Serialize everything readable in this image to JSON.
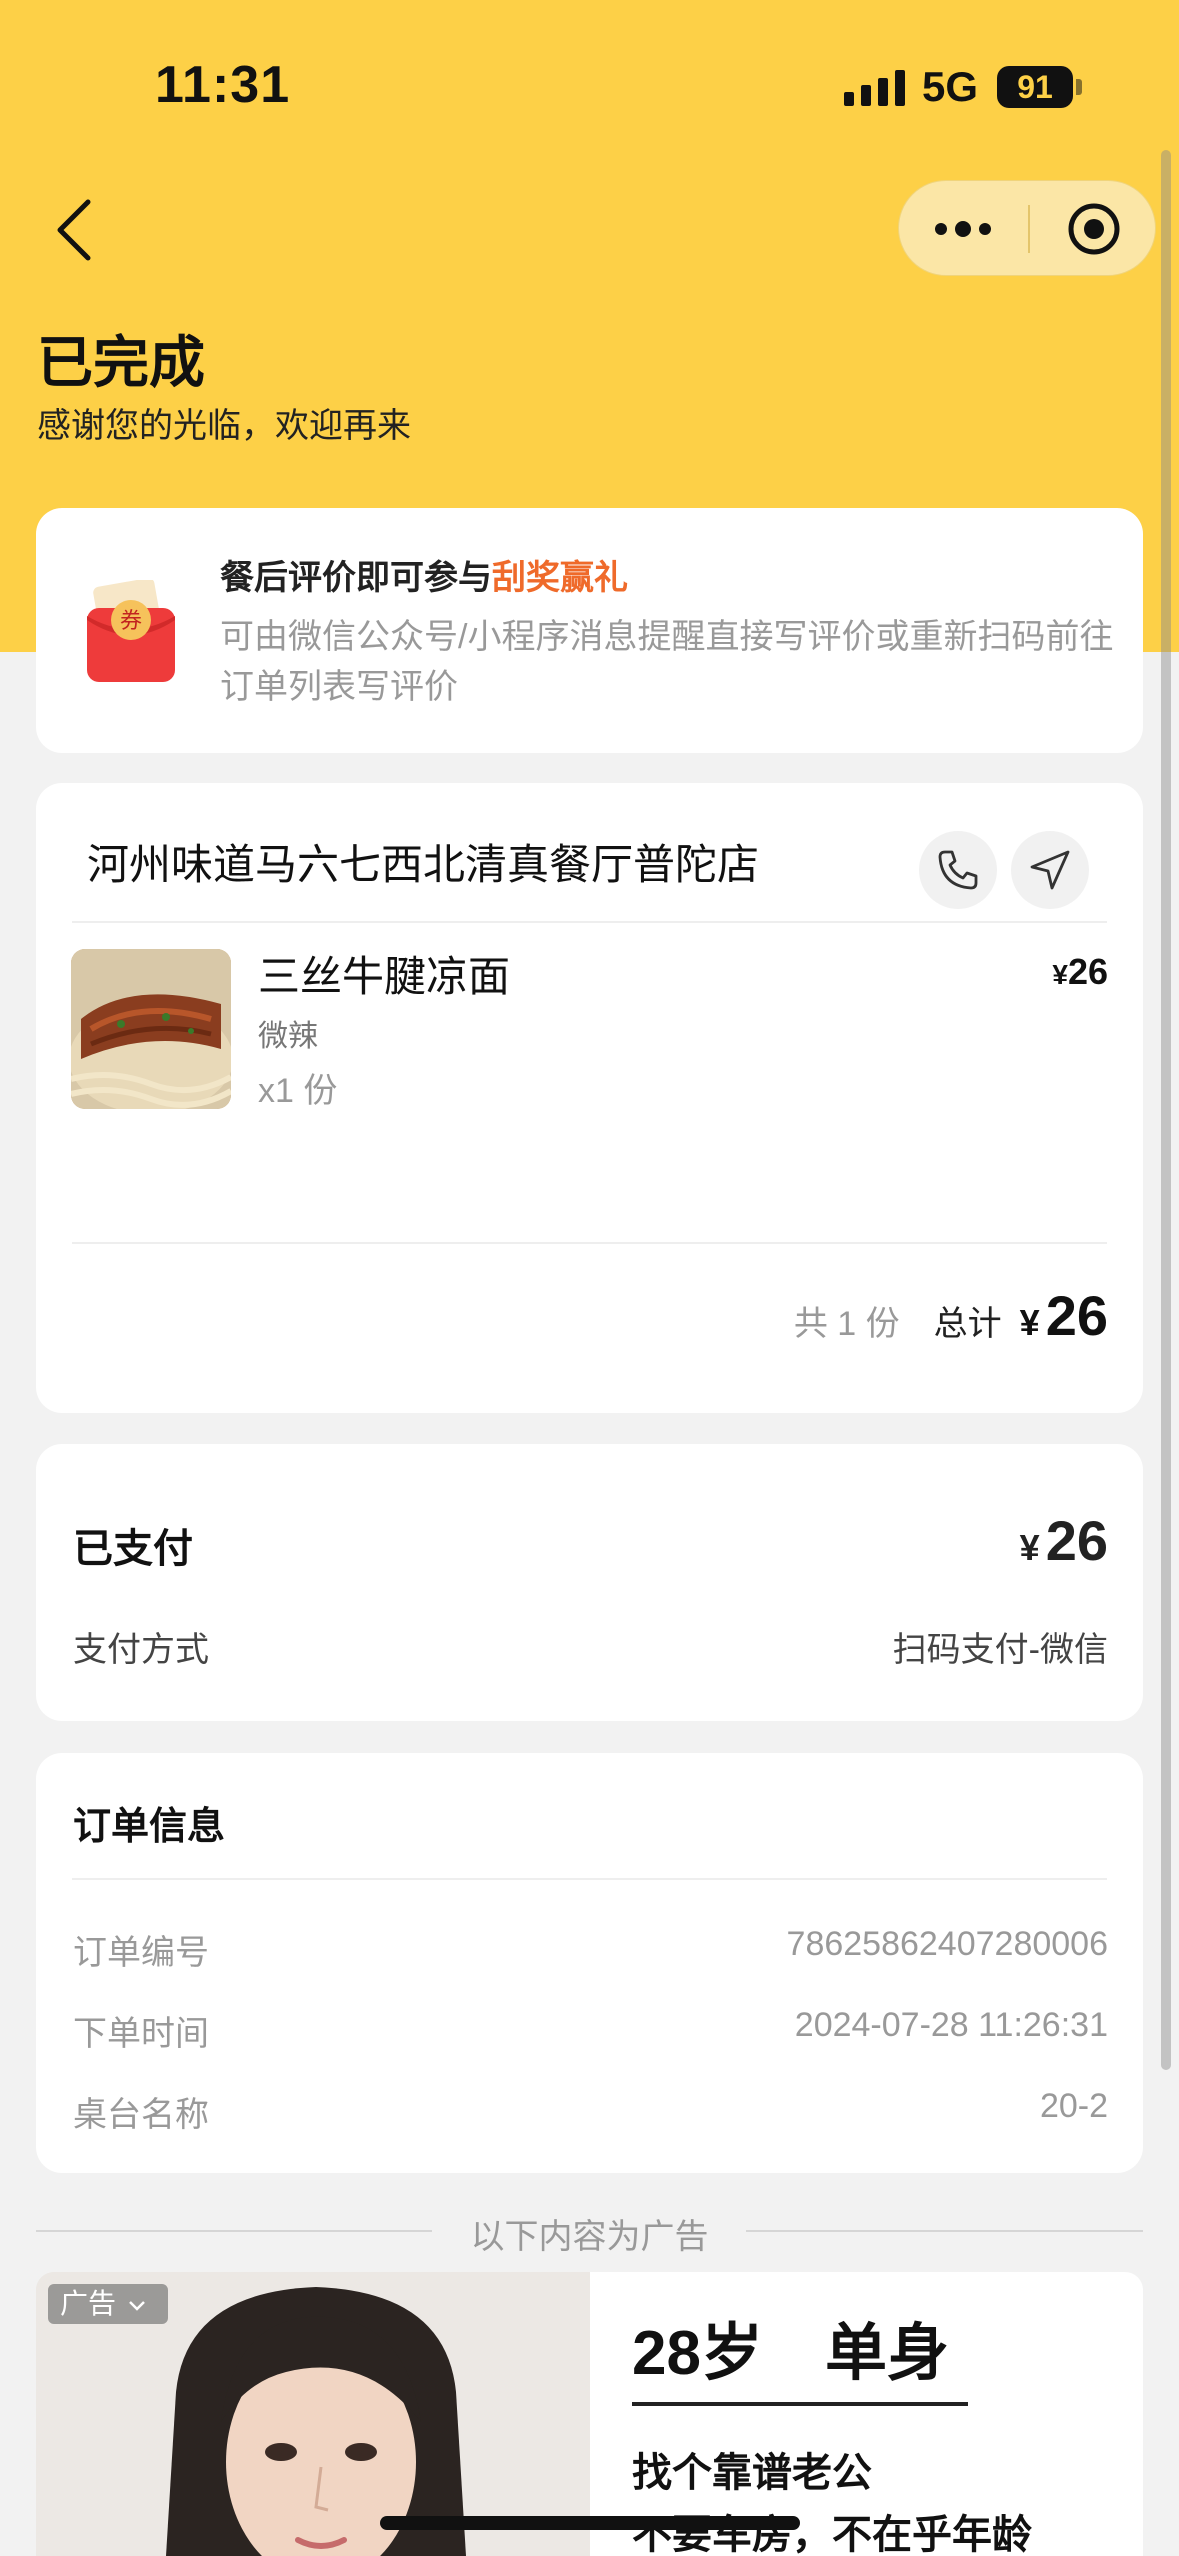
{
  "status_bar": {
    "time": "11:31",
    "network": "5G",
    "battery": "91"
  },
  "header": {
    "title": "已完成",
    "subtitle": "感谢您的光临，欢迎再来"
  },
  "review_promo": {
    "coupon_icon_text": "券",
    "title_prefix": "餐后评价即可参与",
    "title_highlight": "刮奖赢礼",
    "description": "可由微信公众号/小程序消息提醒直接写评价或重新扫码前往订单列表写评价"
  },
  "order": {
    "shop_name": "河州味道马六七西北清真餐厅普陀店",
    "items": [
      {
        "name": "三丝牛腱凉面",
        "spec": "微辣",
        "quantity": "x1 份",
        "currency": "¥",
        "price": "26"
      }
    ],
    "count_text": "共 1 份",
    "total_label": "总计",
    "total_currency": "¥",
    "total_value": "26"
  },
  "payment": {
    "paid_label": "已支付",
    "currency": "¥",
    "amount": "26",
    "method_label": "支付方式",
    "method_value": "扫码支付-微信"
  },
  "order_info": {
    "title": "订单信息",
    "rows": [
      {
        "key": "订单编号",
        "value": "78625862407280006"
      },
      {
        "key": "下单时间",
        "value": "2024-07-28 11:26:31"
      },
      {
        "key": "桌台名称",
        "value": "20-2"
      }
    ]
  },
  "ad": {
    "divider_text": "以下内容为广告",
    "badge": "广告",
    "headline": "28岁　单身",
    "line1": "找个靠谱老公",
    "line2": "不要车房，不在乎年龄"
  },
  "colors": {
    "hero": "#fdd047",
    "accent": "#ef6a2a",
    "background": "#f2f2f2"
  }
}
